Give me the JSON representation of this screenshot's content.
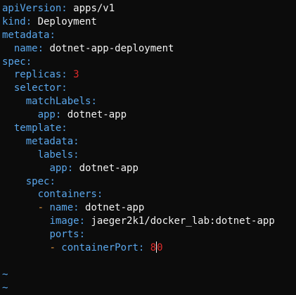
{
  "editor": {
    "lines": [
      {
        "indent": "",
        "key": "apiVersion",
        "value": "apps/v1"
      },
      {
        "indent": "",
        "key": "kind",
        "value": "Deployment"
      },
      {
        "indent": "",
        "key": "metadata",
        "value": ""
      },
      {
        "indent": "  ",
        "key": "name",
        "value": "dotnet-app-deployment"
      },
      {
        "indent": "",
        "key": "spec",
        "value": ""
      },
      {
        "indent": "  ",
        "key": "replicas",
        "number": "3"
      },
      {
        "indent": "  ",
        "key": "selector",
        "value": ""
      },
      {
        "indent": "    ",
        "key": "matchLabels",
        "value": ""
      },
      {
        "indent": "      ",
        "key": "app",
        "value": "dotnet-app"
      },
      {
        "indent": "  ",
        "key": "template",
        "value": ""
      },
      {
        "indent": "    ",
        "key": "metadata",
        "value": ""
      },
      {
        "indent": "      ",
        "key": "labels",
        "value": ""
      },
      {
        "indent": "        ",
        "key": "app",
        "value": "dotnet-app"
      },
      {
        "indent": "    ",
        "key": "spec",
        "value": ""
      },
      {
        "indent": "      ",
        "key": "containers",
        "value": ""
      },
      {
        "indent": "      ",
        "dash": "- ",
        "key": "name",
        "value": "dotnet-app"
      },
      {
        "indent": "        ",
        "key": "image",
        "value": "jaeger2k1/docker_lab:dotnet-app"
      },
      {
        "indent": "        ",
        "key": "ports",
        "value": ""
      },
      {
        "indent": "        ",
        "dash": "- ",
        "key": "containerPort",
        "number_before_cursor": "8",
        "number_after_cursor": "0"
      }
    ],
    "empty_line_markers": [
      "~",
      "~"
    ]
  }
}
